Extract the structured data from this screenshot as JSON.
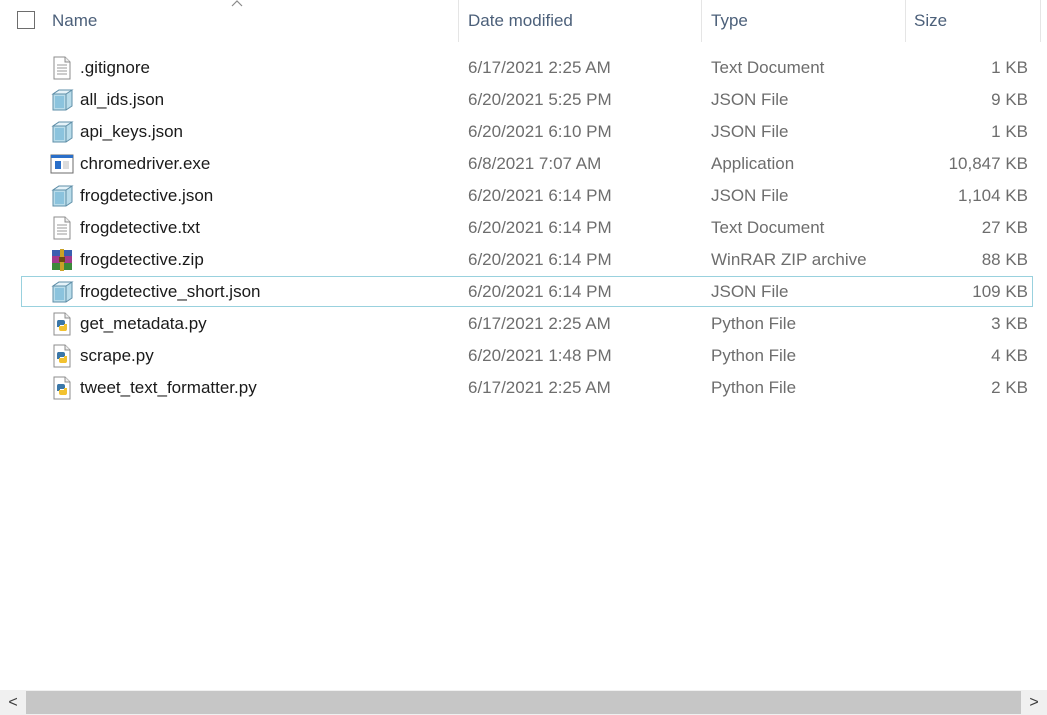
{
  "columns": {
    "name": "Name",
    "date": "Date modified",
    "type": "Type",
    "size": "Size"
  },
  "files": [
    {
      "name": ".gitignore",
      "date": "6/17/2021 2:25 AM",
      "type": "Text Document",
      "size": "1 KB",
      "icon": "text-document-icon"
    },
    {
      "name": "all_ids.json",
      "date": "6/20/2021 5:25 PM",
      "type": "JSON File",
      "size": "9 KB",
      "icon": "json-file-icon"
    },
    {
      "name": "api_keys.json",
      "date": "6/20/2021 6:10 PM",
      "type": "JSON File",
      "size": "1 KB",
      "icon": "json-file-icon"
    },
    {
      "name": "chromedriver.exe",
      "date": "6/8/2021 7:07 AM",
      "type": "Application",
      "size": "10,847 KB",
      "icon": "application-icon"
    },
    {
      "name": "frogdetective.json",
      "date": "6/20/2021 6:14 PM",
      "type": "JSON File",
      "size": "1,104 KB",
      "icon": "json-file-icon"
    },
    {
      "name": "frogdetective.txt",
      "date": "6/20/2021 6:14 PM",
      "type": "Text Document",
      "size": "27 KB",
      "icon": "text-document-icon"
    },
    {
      "name": "frogdetective.zip",
      "date": "6/20/2021 6:14 PM",
      "type": "WinRAR ZIP archive",
      "size": "88 KB",
      "icon": "winrar-archive-icon"
    },
    {
      "name": "frogdetective_short.json",
      "date": "6/20/2021 6:14 PM",
      "type": "JSON File",
      "size": "109 KB",
      "icon": "json-file-icon",
      "selected": true
    },
    {
      "name": "get_metadata.py",
      "date": "6/17/2021 2:25 AM",
      "type": "Python File",
      "size": "3 KB",
      "icon": "python-file-icon"
    },
    {
      "name": "scrape.py",
      "date": "6/20/2021 1:48 PM",
      "type": "Python File",
      "size": "4 KB",
      "icon": "python-file-icon"
    },
    {
      "name": "tweet_text_formatter.py",
      "date": "6/17/2021 2:25 AM",
      "type": "Python File",
      "size": "2 KB",
      "icon": "python-file-icon"
    }
  ],
  "scrollbar": {
    "left_arrow": "<",
    "right_arrow": ">"
  },
  "colors": {
    "header_text": "#4c607a",
    "row_text": "#6d6d6d",
    "selection_border": "#99d1de"
  }
}
